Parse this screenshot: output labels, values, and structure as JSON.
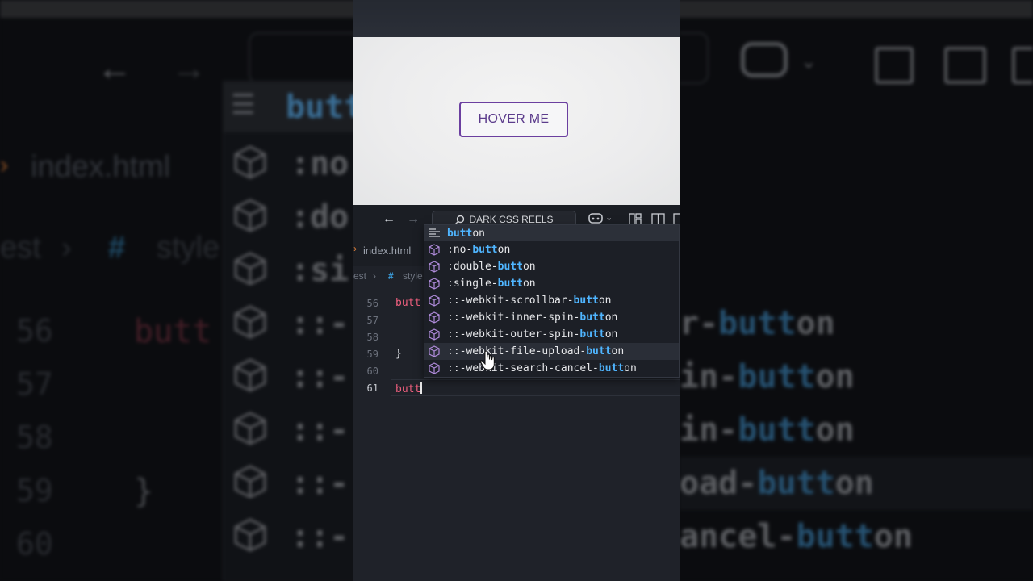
{
  "background": {
    "filename": "index.html",
    "breadcrumb_tail": "est",
    "breadcrumb_hash": "#",
    "breadcrumb_file": "style",
    "zoom_head": "butt",
    "zoom_items": [
      ":no",
      ":do",
      ":si",
      "::-",
      "::-",
      "::-",
      "::-",
      "::-"
    ],
    "line_numbers": [
      "56",
      "57",
      "58",
      "59",
      "60"
    ],
    "code_56": "butt",
    "code_59": "}",
    "right_fragments": [
      {
        "pre": "r-",
        "match": "butt",
        "post": "on"
      },
      {
        "pre": "in-",
        "match": "butt",
        "post": "on"
      },
      {
        "pre": "in-",
        "match": "butt",
        "post": "on"
      },
      {
        "pre": "oad-",
        "match": "butt",
        "post": "on"
      },
      {
        "pre": "ancel-",
        "match": "butt",
        "post": "on"
      }
    ]
  },
  "preview": {
    "button_label": "HOVER ME"
  },
  "titlebar": {
    "search_label": "DARK CSS REELS"
  },
  "tabs": {
    "file_label": "index.html"
  },
  "breadcrumbs": {
    "folder": "est",
    "hash": "#",
    "file": "style"
  },
  "code": {
    "lines": [
      {
        "num": "56",
        "text": "butt"
      },
      {
        "num": "57",
        "text": ""
      },
      {
        "num": "58",
        "text": ""
      },
      {
        "num": "59",
        "text": "}"
      },
      {
        "num": "60",
        "text": ""
      },
      {
        "num": "61",
        "text": "butt"
      }
    ]
  },
  "suggest": {
    "header": {
      "match": "butt",
      "rest": "on"
    },
    "items": [
      {
        "pre": ":no-",
        "match": "butt",
        "post": "on"
      },
      {
        "pre": ":double-",
        "match": "butt",
        "post": "on"
      },
      {
        "pre": ":single-",
        "match": "butt",
        "post": "on"
      },
      {
        "pre": "::-webkit-scrollbar-",
        "match": "butt",
        "post": "on"
      },
      {
        "pre": "::-webkit-inner-spin-",
        "match": "butt",
        "post": "on"
      },
      {
        "pre": "::-webkit-outer-spin-",
        "match": "butt",
        "post": "on"
      },
      {
        "pre": "::-webkit-file-upload-",
        "match": "butt",
        "post": "on"
      },
      {
        "pre": "::-webkit-search-cancel-",
        "match": "butt",
        "post": "on"
      }
    ]
  },
  "colors": {
    "accent_purple": "#6b3fa0",
    "match_blue": "#4fb5ff",
    "selector_red": "#f0607f"
  }
}
